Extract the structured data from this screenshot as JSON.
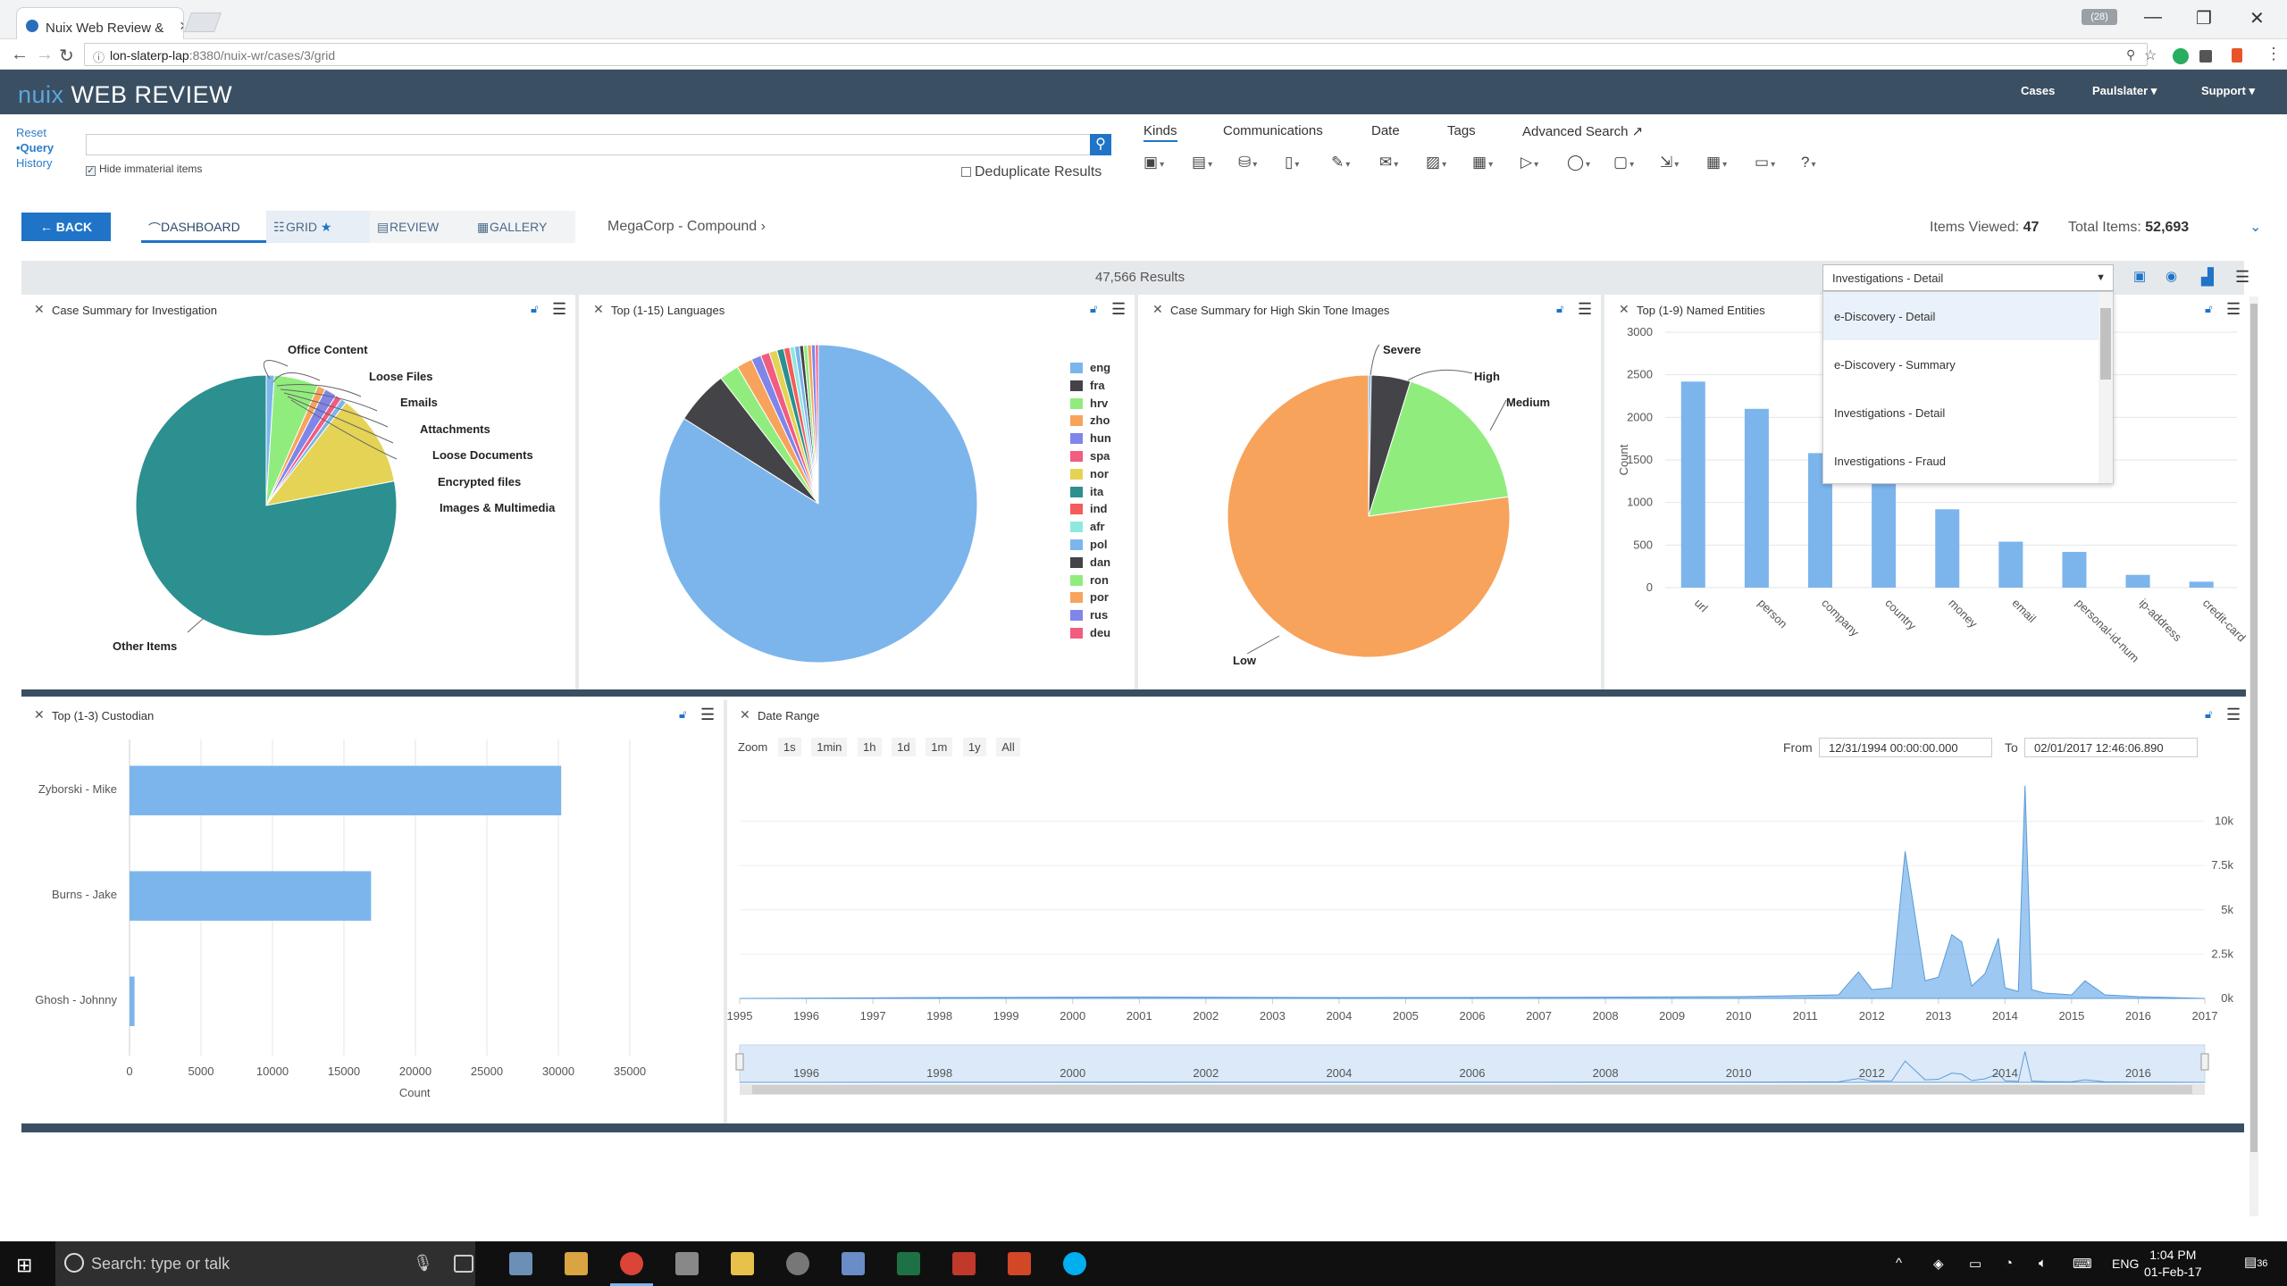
{
  "browser": {
    "tab_title": "Nuix Web Review &",
    "tab_close": "×",
    "window_badge": "(28)",
    "win_min": "—",
    "win_restore": "❐",
    "win_close": "✕",
    "address_host": "lon-slaterp-lap",
    "address_path": ":8380/nuix-wr/cases/3/grid"
  },
  "header": {
    "logo_brand": "nuix",
    "logo_product": "WEB REVIEW",
    "cases": "Cases",
    "user": "Paulslater",
    "support": "Support"
  },
  "search": {
    "reset": "Reset",
    "query": "•Query",
    "history": "History",
    "hide_immaterial": "Hide immaterial items",
    "deduplicate": "Deduplicate Results",
    "filter_tabs": [
      "Kinds",
      "Communications",
      "Date",
      "Tags",
      "Advanced Search"
    ]
  },
  "toolbar": {
    "back": "BACK",
    "views": [
      "DASHBOARD",
      "GRID",
      "REVIEW",
      "GALLERY"
    ],
    "breadcrumb": "MegaCorp - Compound",
    "items_viewed_label": "Items Viewed:",
    "items_viewed": "47",
    "total_items_label": "Total Items:",
    "total_items": "52,693"
  },
  "dashboard": {
    "results": "47,566 Results",
    "preset_selected": "Investigations - Detail",
    "preset_options": [
      "e-Discovery - Detail",
      "e-Discovery - Summary",
      "Investigations - Detail",
      "Investigations - Fraud"
    ]
  },
  "panels": {
    "p1": "Case Summary for Investigation",
    "p2": "Top (1-15) Languages",
    "p3": "Case Summary for High Skin Tone Images",
    "p4": "Top (1-9) Named Entities",
    "p5": "Top (1-3) Custodian",
    "p6": "Date Range"
  },
  "date_range": {
    "zoom_label": "Zoom",
    "zoom_buttons": [
      "1s",
      "1min",
      "1h",
      "1d",
      "1m",
      "1y",
      "All"
    ],
    "from_label": "From",
    "from_value": "12/31/1994 00:00:00.000",
    "to_label": "To",
    "to_value": "02/01/2017 12:46:06.890"
  },
  "taskbar": {
    "search_placeholder": "Search: type or talk",
    "lang": "ENG",
    "time": "1:04 PM",
    "date": "01-Feb-17",
    "notif": "36"
  },
  "chart_data": [
    {
      "type": "pie",
      "title": "Case Summary for Investigation",
      "categories": [
        "Office Content",
        "Loose Files",
        "Emails",
        "Attachments",
        "Loose Documents",
        "Encrypted files",
        "Images & Multimedia",
        "Other Items"
      ],
      "values": [
        1.0,
        5.5,
        1.0,
        1.5,
        0.8,
        0.7,
        11.5,
        78.0
      ],
      "colors": [
        "#7cb5ec",
        "#90ed7d",
        "#f7a35c",
        "#8085e9",
        "#f15c80",
        "#7cb5ec",
        "#e4d354",
        "#2b908f"
      ]
    },
    {
      "type": "pie",
      "title": "Top (1-15) Languages",
      "categories": [
        "eng",
        "fra",
        "hrv",
        "zho",
        "hun",
        "spa",
        "nor",
        "ita",
        "ind",
        "afr",
        "pol",
        "dan",
        "ron",
        "por",
        "rus",
        "deu"
      ],
      "values": [
        84.0,
        5.5,
        2.0,
        1.6,
        1.0,
        0.9,
        0.8,
        0.7,
        0.6,
        0.5,
        0.5,
        0.4,
        0.4,
        0.4,
        0.4,
        0.3
      ],
      "colors": [
        "#7cb5ec",
        "#434348",
        "#90ed7d",
        "#f7a35c",
        "#8085e9",
        "#f15c80",
        "#e4d354",
        "#2b908f",
        "#f45b5b",
        "#91e8e1",
        "#7cb5ec",
        "#434348",
        "#90ed7d",
        "#f7a35c",
        "#8085e9",
        "#f15c80"
      ]
    },
    {
      "type": "pie",
      "title": "Case Summary for High Skin Tone Images",
      "categories": [
        "Severe",
        "High",
        "Medium",
        "Low"
      ],
      "values": [
        0.3,
        4.5,
        18.0,
        77.2
      ],
      "colors": [
        "#7cb5ec",
        "#434348",
        "#90ed7d",
        "#f7a35c"
      ]
    },
    {
      "type": "bar",
      "title": "Top (1-9) Named Entities",
      "categories": [
        "url",
        "person",
        "company",
        "country",
        "money",
        "email",
        "personal-id-num",
        "ip-address",
        "credit-card"
      ],
      "values": [
        2420,
        2100,
        1580,
        1400,
        920,
        540,
        420,
        150,
        70
      ],
      "ylabel": "Count",
      "ylim": [
        0,
        3000
      ],
      "yticks": [
        0,
        500,
        1000,
        1500,
        2000,
        2500,
        3000
      ]
    },
    {
      "type": "bar",
      "orientation": "horizontal",
      "title": "Top (1-3) Custodian",
      "categories": [
        "Zyborski - Mike",
        "Burns - Jake",
        "Ghosh - Johnny"
      ],
      "values": [
        30200,
        16900,
        350
      ],
      "xlabel": "Count",
      "xlim": [
        0,
        35000
      ],
      "xticks": [
        0,
        5000,
        10000,
        15000,
        20000,
        25000,
        30000,
        35000
      ]
    },
    {
      "type": "area",
      "title": "Date Range",
      "x": [
        1995,
        1998,
        2001,
        2004,
        2007,
        2010,
        2011.5,
        2011.8,
        2012.0,
        2012.3,
        2012.5,
        2012.8,
        2013.0,
        2013.2,
        2013.35,
        2013.5,
        2013.7,
        2013.9,
        2014.0,
        2014.2,
        2014.3,
        2014.4,
        2014.6,
        2015.0,
        2015.2,
        2015.5,
        2016.0,
        2017.0
      ],
      "values": [
        0,
        50,
        80,
        50,
        60,
        100,
        200,
        1500,
        500,
        600,
        8300,
        1000,
        1200,
        3600,
        3200,
        700,
        1400,
        3400,
        600,
        400,
        12000,
        500,
        300,
        200,
        1000,
        200,
        100,
        0
      ],
      "xticks": [
        1995,
        1996,
        1997,
        1998,
        1999,
        2000,
        2001,
        2002,
        2003,
        2004,
        2005,
        2006,
        2007,
        2008,
        2009,
        2010,
        2011,
        2012,
        2013,
        2014,
        2015,
        2016,
        2017
      ],
      "ylim": [
        0,
        12500
      ],
      "ytick_labels": [
        "0k",
        "2.5k",
        "5k",
        "7.5k",
        "10k"
      ],
      "navigator_labels": [
        "1996",
        "1998",
        "2000",
        "2002",
        "2004",
        "2006",
        "2008",
        "2010",
        "2012",
        "2014",
        "2016"
      ]
    }
  ]
}
